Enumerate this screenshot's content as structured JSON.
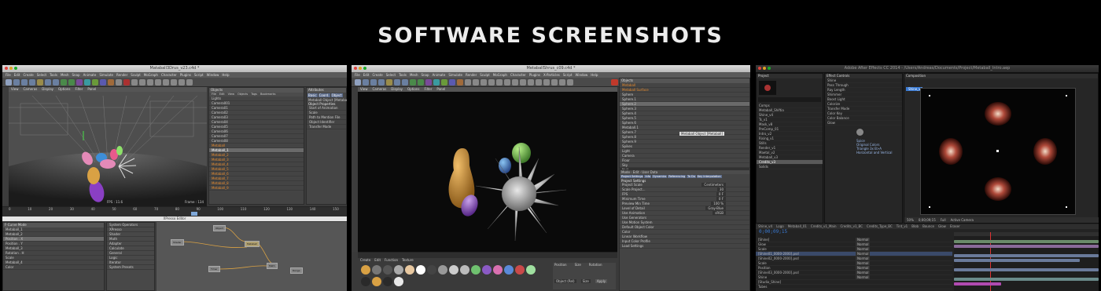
{
  "heading": "SOFTWARE SCREENSHOTS",
  "screens": [
    {
      "app": "Cinema 4D",
      "window_title": "Mataball3Drus_v23.c4d *",
      "menu": [
        "File",
        "Edit",
        "Create",
        "Select",
        "Tools",
        "Mesh",
        "Snap",
        "Animate",
        "Simulate",
        "Render",
        "Sculpt",
        "MoGraph",
        "Character",
        "Plugins",
        "Script",
        "Window",
        "Help"
      ],
      "viewport_tabs": [
        "View",
        "Cameras",
        "Display",
        "Options",
        "Filter",
        "Panel"
      ],
      "viewport_label": "Perspective",
      "fps": "FPS : 11.6",
      "frame_label": "Frame : 134",
      "objects_header": "Objects",
      "objects_tabs": [
        "File",
        "Edit",
        "View",
        "Objects",
        "Tags",
        "Bookmarks"
      ],
      "objects": [
        "Lights",
        "Camera001",
        "Camera01",
        "Camera02",
        "Camera03",
        "Camera04",
        "Camera05",
        "Camera06",
        "Camera07",
        "Camera08",
        "Metaball",
        "Metaball_1",
        "Metaball_2",
        "Metaball_3",
        "Metaball_4",
        "Metaball_5",
        "Metaball_6",
        "Metaball_7",
        "Metaball_8",
        "Metaball_9"
      ],
      "attributes_header": "Attributes",
      "attr_tabs": [
        "Basic",
        "Coord.",
        "Object"
      ],
      "attr_title": "Metaball Object [Metaball_1]",
      "attr_section": "Object Properties",
      "attr_rows": [
        "Start of Animation",
        "Scale",
        "Path to Mention File",
        "Object Identifier",
        "Transfer Mode"
      ],
      "bottom_title": "XPresso Editor",
      "curve_mode": "F-Curve Mode",
      "timeline_ticks": [
        "0",
        "10",
        "20",
        "30",
        "40",
        "50",
        "60",
        "70",
        "80",
        "90",
        "100",
        "110",
        "120",
        "130",
        "140",
        "150"
      ],
      "xp_nodes": [
        "Object",
        "Shader",
        "Metaball",
        "Timer",
        "Math",
        "Range"
      ]
    },
    {
      "app": "Cinema 4D",
      "window_title": "MetaballShrus_c09.c4d *",
      "menu": [
        "File",
        "Edit",
        "Create",
        "Select",
        "Tools",
        "Mesh",
        "Snap",
        "Animate",
        "Simulate",
        "Render",
        "Sculpt",
        "MoGraph",
        "Character",
        "Plugins",
        "X-Particles",
        "Script",
        "Window",
        "Help"
      ],
      "viewport_tabs": [
        "View",
        "Cameras",
        "Display",
        "Options",
        "Filter",
        "Panel"
      ],
      "objects_header": "Objects",
      "object_hint": "Metaball Object [Metaball]",
      "attr_tabs": [
        "Project Settings",
        "Info",
        "Dynamics",
        "Referencing",
        "To Do",
        "Key Interpolation"
      ],
      "attr_section": "Project Settings",
      "attr_rows": [
        "Project Scale",
        "Scale Project...",
        "FPS",
        "Minimum Time",
        "Preview Min Time",
        "Level of Detail",
        "Use Animation",
        "Use Generators",
        "Use Motion System",
        "Default Object Color",
        "Color",
        "Linear Workflow",
        "Input Color Profile",
        "Load Settings"
      ],
      "attr_values": [
        "Centimeters",
        "30",
        "0 F",
        "0 F",
        "100 %",
        "Gray-Blue",
        "sRGB"
      ],
      "material_tabs": [
        "Create",
        "Edit",
        "Function",
        "Texture"
      ],
      "coord_labels": [
        "Position",
        "Size",
        "Rotation"
      ],
      "apply_label": "Apply",
      "object_rel_label": "Object (Rel)",
      "size_label": "Size"
    },
    {
      "app": "After Effects",
      "window_title": "Adobe After Effects CC 2014 - /Users/Andreas/Documents/Project/Metaball_Intro.aep",
      "project_header": "Project",
      "effects_header": "Effect Controls",
      "comp_header": "Composition",
      "comp_name": "Shine_v4",
      "effect_items": [
        "Shine",
        "Pass Through",
        "Ray Length",
        "Shimmer",
        "Boost Light",
        "Colorize",
        "Transfer Mode",
        "Color Key",
        "Color Balance",
        "Glow"
      ],
      "effect_values": [
        "Spice",
        "Original Colors",
        "Triangle 3x B>A",
        "Horizontal and Vertical"
      ],
      "project_items": [
        "Comps",
        "Metaball_Shiftia",
        "Shine_v4",
        "Ts_v1",
        "Mask_v8",
        "PreComp_01",
        "Intro_v2",
        "Rising_v1",
        "Stills",
        "Render_v1",
        "Maetal_v2",
        "Metaball_v3",
        "Credits_v3",
        "Solids"
      ],
      "comp_zoom": "50%",
      "comp_time": "0;00;09;15",
      "comp_view": "Active Camera",
      "comp_res": "Full",
      "timeline_tabs": [
        "Shine_v4",
        "Logo",
        "Metaball_01",
        "Credits_v1_Main",
        "Credits_v1_BC",
        "Credits_Type_BC",
        "Tint_v1",
        "Blob",
        "Bounce",
        "Glow",
        "Eraser"
      ],
      "layer_names": [
        "[Shine]",
        "Glow",
        "Scale",
        "[Shine01_0000-2000].psd",
        "[Shine02_0000-2000].psd",
        "Scale",
        "Position",
        "[Shine03_0000-2000].psd",
        "Shine",
        "[Studio_Shine]",
        "Tubes"
      ],
      "modes": [
        "Normal",
        "Normal",
        "Normal",
        "Normal",
        "Normal",
        "Normal",
        "Normal",
        "Normal",
        "Normal"
      ],
      "timecode": "0;00;09;15"
    }
  ],
  "colors": {
    "bg": "#000000",
    "heading": "#ececec",
    "c4d_panel": "#444444",
    "ae_panel": "#232323",
    "accent_orange": "#e58a2e",
    "ae_blue": "#3a7bd5"
  }
}
